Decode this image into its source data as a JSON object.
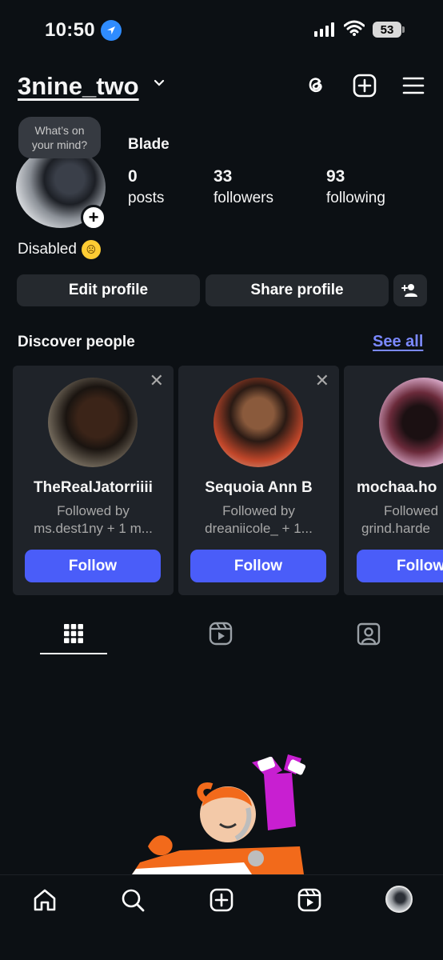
{
  "status_bar": {
    "time": "10:50",
    "battery": "53"
  },
  "header": {
    "username": "3nine_two"
  },
  "profile": {
    "note_bubble_line1": "What’s on",
    "note_bubble_line2": "your mind?",
    "display_name": "Blade",
    "stats": [
      {
        "value": "0",
        "label": "posts"
      },
      {
        "value": "33",
        "label": "followers"
      },
      {
        "value": "93",
        "label": "following"
      }
    ],
    "bio": "Disabled",
    "bio_emoji": "☹"
  },
  "actions": {
    "edit_profile": "Edit profile",
    "share_profile": "Share profile"
  },
  "discover": {
    "title": "Discover people",
    "see_all": "See all",
    "cards": [
      {
        "name": "TheRealJatorriiii",
        "line1": "Followed by",
        "line2": "ms.dest1ny + 1 m...",
        "button": "Follow"
      },
      {
        "name": "Sequoia Ann B",
        "line1": "Followed by",
        "line2": "dreaniicole_ + 1...",
        "button": "Follow"
      },
      {
        "name": "mochaa.ho",
        "line1": "Followed",
        "line2": "grind.harde",
        "button": "Follow"
      }
    ]
  },
  "colors": {
    "background": "#0c1014",
    "button_bg": "#25292e",
    "follow_blue": "#4a5df9",
    "link_blue": "#7b89ff"
  }
}
